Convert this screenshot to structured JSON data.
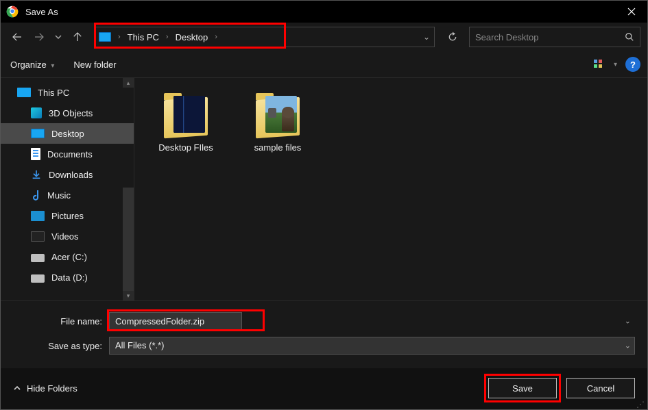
{
  "window": {
    "title": "Save As"
  },
  "breadcrumb": {
    "root": "This PC",
    "leaf": "Desktop"
  },
  "search": {
    "placeholder": "Search Desktop"
  },
  "toolbar": {
    "organize": "Organize",
    "new_folder": "New folder"
  },
  "sidebar": {
    "this_pc": "This PC",
    "items": [
      {
        "label": "3D Objects"
      },
      {
        "label": "Desktop",
        "selected": true
      },
      {
        "label": "Documents"
      },
      {
        "label": "Downloads"
      },
      {
        "label": "Music"
      },
      {
        "label": "Pictures"
      },
      {
        "label": "Videos"
      },
      {
        "label": "Acer (C:)"
      },
      {
        "label": "Data (D:)"
      }
    ]
  },
  "content": {
    "items": [
      {
        "label": "Desktop FIles"
      },
      {
        "label": "sample files"
      }
    ]
  },
  "form": {
    "filename_label": "File name:",
    "filename_value": "CompressedFolder.zip",
    "type_label": "Save as type:",
    "type_value": "All Files (*.*)"
  },
  "actions": {
    "hide_folders": "Hide Folders",
    "save": "Save",
    "cancel": "Cancel"
  }
}
